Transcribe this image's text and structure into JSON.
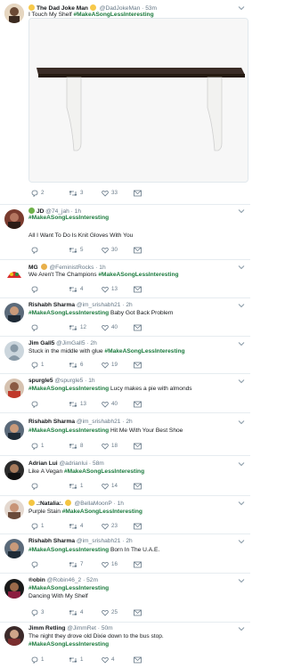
{
  "tweets": [
    {
      "display_name": "The Dad Joke Man",
      "handle": "@DadJokeMan",
      "sep": "·",
      "time": "53m",
      "text_pre": "I Touch My Shelf ",
      "hashtag": "#MakeASongLessInteresting",
      "text_post": "",
      "replies": "2",
      "retweets": "3",
      "likes": "33"
    },
    {
      "display_name": "JD",
      "handle": "@74_jah",
      "sep": "·",
      "time": "1h",
      "hashtag": "#MakeASongLessInteresting",
      "line2": "All I Want To Do Is Knit Gloves With You",
      "replies": "",
      "retweets": "5",
      "likes": "30"
    },
    {
      "display_name": "MG",
      "handle": "@FeministRocks",
      "sep": "·",
      "time": "1h",
      "text_pre": "We Aren't The Champions  ",
      "hashtag": "#MakeASongLessInteresting",
      "text_post": "",
      "replies": "",
      "retweets": "4",
      "likes": "13"
    },
    {
      "display_name": "Rishabh Sharma",
      "handle": "@im_srishabh21",
      "sep": "·",
      "time": "2h",
      "text_pre": "",
      "hashtag": "#MakeASongLessInteresting",
      "text_post": " Baby Got Back Problem",
      "replies": "",
      "retweets": "12",
      "likes": "40"
    },
    {
      "display_name": "Jim Gall5",
      "handle": "@JimGall5",
      "sep": "·",
      "time": "2h",
      "text_pre": "Stuck in the middle with glue ",
      "hashtag": "#MakeASongLessInteresting",
      "text_post": "",
      "replies": "1",
      "retweets": "6",
      "likes": "19"
    },
    {
      "display_name": "spurgle5",
      "handle": "@spurgle5",
      "sep": "·",
      "time": "1h",
      "text_pre": "",
      "hashtag": "#MakeASongLessInteresting",
      "text_post": " Lucy makes a pie with almonds",
      "replies": "",
      "retweets": "13",
      "likes": "40"
    },
    {
      "display_name": "Rishabh Sharma",
      "handle": "@im_srishabh21",
      "sep": "·",
      "time": "2h",
      "text_pre": "",
      "hashtag": "#MakeASongLessInteresting",
      "text_post": " Hit Me With Your Best Shoe",
      "replies": "1",
      "retweets": "8",
      "likes": "18"
    },
    {
      "display_name": "Adrian Lui",
      "handle": "@adrianlui",
      "sep": "·",
      "time": "58m",
      "text_pre": "Like A Vegan ",
      "hashtag": "#MakeASongLessInteresting",
      "text_post": "",
      "replies": "",
      "retweets": "1",
      "likes": "14"
    },
    {
      "display_name": ".:Natalia:.",
      "handle": "@BellaMoonP",
      "sep": "·",
      "time": "1h",
      "text_pre": "Purple Stain ",
      "hashtag": "#MakeASongLessInteresting",
      "text_post": "",
      "replies": "1",
      "retweets": "4",
      "likes": "23"
    },
    {
      "display_name": "Rishabh Sharma",
      "handle": "@im_srishabh21",
      "sep": "·",
      "time": "2h",
      "text_pre": "",
      "hashtag": "#MakeASongLessInteresting",
      "text_post": " Born In The U.A.E.",
      "replies": "",
      "retweets": "7",
      "likes": "16"
    },
    {
      "display_name": "®obin",
      "handle": "@Robin46_2",
      "sep": "·",
      "time": "52m",
      "hashtag": "#MakeASongLessInteresting",
      "line2": "Dancing With My Shelf",
      "replies": "3",
      "retweets": "4",
      "likes": "25"
    },
    {
      "display_name": "Jimm Retling",
      "handle": "@JimmRet",
      "sep": "·",
      "time": "50m",
      "line1": "The night they drove old Dixie down to the bus stop.",
      "hashtag": "#MakeASongLessInteresting",
      "replies": "1",
      "retweets": "1",
      "likes": "4"
    }
  ],
  "colors": {
    "hashtag": "#1b7a3d",
    "muted": "#657786",
    "text": "#14171a",
    "divider": "#e6ecf0"
  }
}
